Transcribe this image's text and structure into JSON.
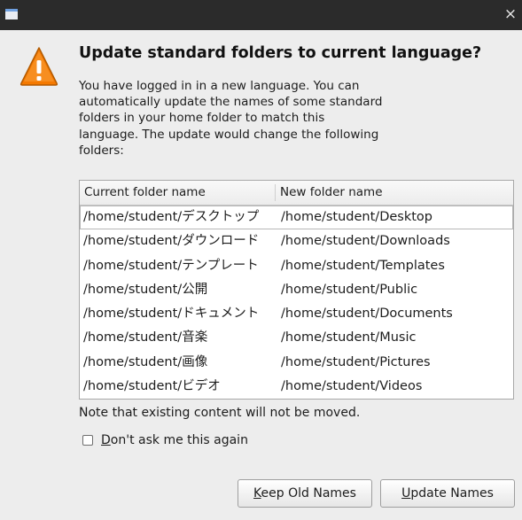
{
  "titlebar": {
    "close_glyph": "×"
  },
  "dialog": {
    "heading": "Update standard folders to current language?",
    "message_lines": [
      "You have logged in in a new language. You can",
      "automatically update the names of some standard",
      "folders in your home folder to match this",
      "language. The update would change the following",
      "folders:"
    ],
    "icon": "warning-icon",
    "accent_color": "#f57900"
  },
  "table": {
    "columns": [
      "Current folder name",
      "New folder name"
    ],
    "rows": [
      [
        "/home/student/デスクトップ",
        "/home/student/Desktop"
      ],
      [
        "/home/student/ダウンロード",
        "/home/student/Downloads"
      ],
      [
        "/home/student/テンプレート",
        "/home/student/Templates"
      ],
      [
        "/home/student/公開",
        "/home/student/Public"
      ],
      [
        "/home/student/ドキュメント",
        "/home/student/Documents"
      ],
      [
        "/home/student/音楽",
        "/home/student/Music"
      ],
      [
        "/home/student/画像",
        "/home/student/Pictures"
      ],
      [
        "/home/student/ビデオ",
        "/home/student/Videos"
      ]
    ]
  },
  "note": "Note that existing content will not be moved.",
  "checkbox": {
    "mnemonic": "D",
    "label_rest": "on't ask me this again",
    "checked": false
  },
  "buttons": {
    "keep": {
      "mnemonic": "K",
      "rest": "eep Old Names"
    },
    "update": {
      "mnemonic": "U",
      "rest": "pdate Names"
    }
  }
}
